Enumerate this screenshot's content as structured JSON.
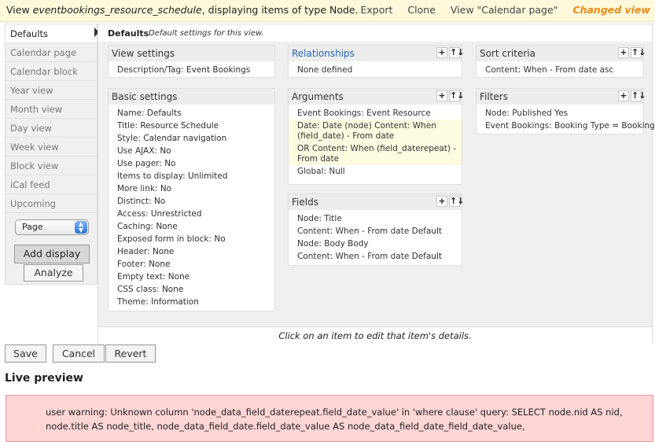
{
  "header": {
    "view_prefix": "View",
    "view_name": "eventbookings_resource_schedule",
    "view_suffix": ", displaying items of type Node.",
    "links": [
      "Export",
      "Clone",
      "View \"Calendar page\""
    ],
    "changed": "Changed view"
  },
  "displays": {
    "tabs": [
      "Defaults",
      "Calendar page",
      "Calendar block",
      "Year view",
      "Month view",
      "Day view",
      "Week view",
      "Block view",
      "iCal feed",
      "Upcoming"
    ],
    "active": "Defaults",
    "select_value": "Page",
    "add_button": "Add display",
    "analyze_button": "Analyze"
  },
  "main": {
    "label": "Defaults",
    "description": "Default settings for this view.",
    "footer_hint": "Click on an item to edit that item's details."
  },
  "view_settings": {
    "title": "View settings",
    "rows": [
      {
        "k": "Description/Tag: ",
        "v": "Event Bookings"
      }
    ]
  },
  "basic_settings": {
    "title": "Basic settings",
    "rows": [
      {
        "k": "Name: ",
        "v": "Defaults"
      },
      {
        "k": "Title: ",
        "v": "Resource Schedule"
      },
      {
        "k": "Style: ",
        "v": "Calendar navigation"
      },
      {
        "k": "Use AJAX: ",
        "v": "No"
      },
      {
        "k": "Use pager: ",
        "v": "No"
      },
      {
        "k": "Items to display: ",
        "v": "Unlimited"
      },
      {
        "k": "More link: ",
        "v": "No"
      },
      {
        "k": "Distinct: ",
        "v": "No"
      },
      {
        "k": "Access: ",
        "v": "Unrestricted"
      },
      {
        "k": "Caching: ",
        "v": "None"
      },
      {
        "k": "Exposed form in block: ",
        "v": "No"
      },
      {
        "k": "Header: ",
        "v": "None"
      },
      {
        "k": "Footer: ",
        "v": "None"
      },
      {
        "k": "Empty text: ",
        "v": "None"
      },
      {
        "k": "CSS class: ",
        "v": "None"
      },
      {
        "k": "Theme: ",
        "v": "Information"
      }
    ]
  },
  "relationships": {
    "title": "Relationships",
    "rows": [
      {
        "k": "None defined",
        "v": ""
      }
    ]
  },
  "arguments": {
    "title": "Arguments",
    "rows": [
      {
        "k": "Event Bookings: Event Resource",
        "v": ""
      },
      {
        "k": "Date: Date (node) Content: When (field_date) - From date",
        "v": ""
      },
      {
        "k": "OR Content: When (field_daterepeat) - From date",
        "v": ""
      },
      {
        "k": "Global: Null",
        "v": ""
      }
    ]
  },
  "fields": {
    "title": "Fields",
    "rows": [
      {
        "k": "Node: Title",
        "v": ""
      },
      {
        "k": "Content: When - From date ",
        "v": "Default"
      },
      {
        "k": "Node: Body ",
        "v": "Body"
      },
      {
        "k": "Content: When - From date ",
        "v": "Default"
      }
    ]
  },
  "sort_criteria": {
    "title": "Sort criteria",
    "rows": [
      {
        "k": "Content: When - From date asc",
        "v": ""
      }
    ]
  },
  "filters": {
    "title": "Filters",
    "rows": [
      {
        "k": "Node: Published Yes",
        "v": ""
      },
      {
        "k": "Event Bookings: Booking Type ",
        "v": "= Booking"
      }
    ]
  },
  "box_icons": {
    "add": "+",
    "rearrange": "↑↓"
  },
  "actions": {
    "save": "Save",
    "cancel": "Cancel",
    "revert": "Revert"
  },
  "live_preview": {
    "heading": "Live preview",
    "warning": "user warning: Unknown column 'node_data_field_daterepeat.field_date_value' in 'where clause' query: SELECT node.nid AS nid, node.title AS node_title, node_data_field_date.field_date_value AS node_data_field_date_field_date_value,"
  }
}
